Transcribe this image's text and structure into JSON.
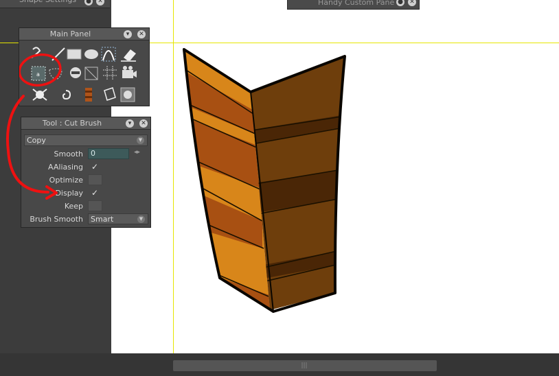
{
  "app": {
    "shape_settings_title": "Shape Settings",
    "handy_pane_title": "Handy Custom Pane"
  },
  "main_panel": {
    "title": "Main Panel",
    "tools": [
      {
        "name": "selection-tool-icon"
      },
      {
        "name": "line-tool-icon"
      },
      {
        "name": "rectangle-tool-icon"
      },
      {
        "name": "ellipse-tool-icon"
      },
      {
        "name": "curve-tool-icon"
      },
      {
        "name": "eraser-tool-icon"
      },
      {
        "name": "cut-brush-tool-icon"
      },
      {
        "name": "lasso-brush-tool-icon"
      },
      {
        "name": "no-entry-tool-icon"
      },
      {
        "name": "transform-tool-icon"
      },
      {
        "name": "grid-tool-icon"
      },
      {
        "name": "camera-tool-icon"
      },
      {
        "name": "skull-bones-icon"
      },
      {
        "name": "spiral-tool-icon"
      },
      {
        "name": "bone-layers-icon"
      },
      {
        "name": "paper-tool-icon"
      },
      {
        "name": "target-tool-icon"
      }
    ]
  },
  "tool_panel": {
    "title": "Tool : Cut Brush",
    "mode_select": "Copy",
    "rows": {
      "smooth_label": "Smooth",
      "smooth_value": "0",
      "aaliasing_label": "AAliasing",
      "aaliasing_check": "✓",
      "optimize_label": "Optimize",
      "display_label": "Display",
      "display_check": "✓",
      "keep_label": "Keep",
      "brush_smooth_label": "Brush Smooth",
      "brush_smooth_value": "Smart"
    }
  },
  "colors": {
    "accent_guide": "#e6e600",
    "annotation_red": "#ee1111",
    "shape_light": "#d8861a",
    "shape_mid": "#a85012",
    "shape_dark": "#6e3e0c"
  },
  "scrollbar": {
    "grip": "|||"
  }
}
